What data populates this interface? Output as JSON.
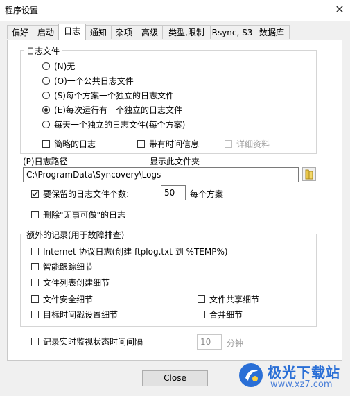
{
  "window": {
    "title": "程序设置",
    "close_glyph": "✕"
  },
  "tabs": [
    {
      "label": "偏好"
    },
    {
      "label": "启动"
    },
    {
      "label": "日志",
      "active": true
    },
    {
      "label": "通知"
    },
    {
      "label": "杂项"
    },
    {
      "label": "高级"
    },
    {
      "label": "类型,限制"
    },
    {
      "label": "Rsync, S3"
    },
    {
      "label": "数据库"
    }
  ],
  "log_files": {
    "group_title": "日志文件",
    "options": [
      {
        "label": "(N)无",
        "checked": false
      },
      {
        "label": "(O)一个公共日志文件",
        "checked": false
      },
      {
        "label": "(S)每个方案一个独立的日志文件",
        "checked": false
      },
      {
        "label": "(E)每次运行有一个独立的日志文件",
        "checked": true
      },
      {
        "label": "每天一个独立的日志文件(每个方案)",
        "checked": false
      }
    ],
    "brief_log": {
      "label": "简略的日志",
      "checked": false
    },
    "with_time": {
      "label": "带有时间信息",
      "checked": false
    },
    "details": {
      "label": "详细资料",
      "checked": false,
      "disabled": true
    }
  },
  "log_path": {
    "label": "(P)日志路径",
    "show_folder": "显示此文件夹",
    "value": "C:\\ProgramData\\Syncovery\\Logs"
  },
  "keep_count": {
    "label": "要保留的日志文件个数:",
    "checked": true,
    "value": "50",
    "suffix": "每个方案"
  },
  "delete_nothing": {
    "label": "删除\"无事可做\"的日志",
    "checked": false
  },
  "extra": {
    "group_title": "额外的记录(用于故障排查)",
    "items": [
      {
        "label": "Internet 协议日志(创建 ftplog.txt 到 %TEMP%)",
        "checked": false
      },
      {
        "label": "智能跟踪细节",
        "checked": false
      },
      {
        "label": "文件列表创建细节",
        "checked": false
      },
      {
        "label": "文件安全细节",
        "checked": false
      },
      {
        "label": "目标时间戳设置细节",
        "checked": false
      },
      {
        "label": "文件共享细节",
        "checked": false
      },
      {
        "label": "合并细节",
        "checked": false
      }
    ]
  },
  "realtime": {
    "label": "记录实时监视状态时间间隔",
    "checked": false,
    "value": "10",
    "unit": "分钟"
  },
  "buttons": {
    "close": "Close"
  },
  "watermark": {
    "line1": "极光下载站",
    "line2": "www.xz7.com"
  },
  "colors": {
    "accent": "#0078d7",
    "watermark_blue": "#2a6fd6"
  }
}
